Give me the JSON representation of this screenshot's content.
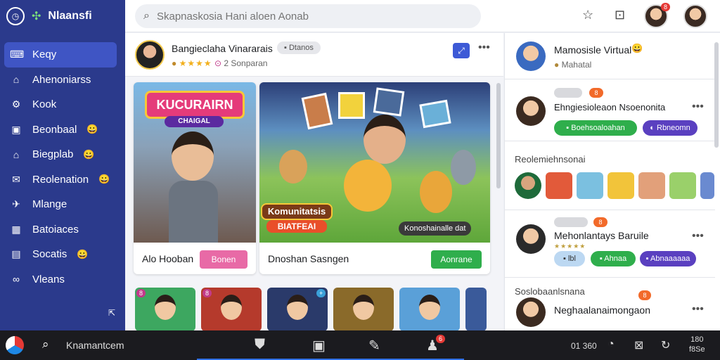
{
  "app": {
    "name": "Nlaansfi"
  },
  "sidebar": {
    "items": [
      {
        "label": "Keqy",
        "icon": "keyboard-icon",
        "emoji": ""
      },
      {
        "label": "Ahenoniarss",
        "icon": "home-icon",
        "emoji": ""
      },
      {
        "label": "Kook",
        "icon": "gear-icon",
        "emoji": ""
      },
      {
        "label": "Beonbaal",
        "icon": "store-icon",
        "emoji": "😀"
      },
      {
        "label": "Biegplab",
        "icon": "home-icon",
        "emoji": "😀"
      },
      {
        "label": "Reolenation",
        "icon": "mail-icon",
        "emoji": "😀"
      },
      {
        "label": "Mlange",
        "icon": "twitter-icon",
        "emoji": ""
      },
      {
        "label": "Batoiaces",
        "icon": "grid-icon",
        "emoji": ""
      },
      {
        "label": "Socatis",
        "icon": "users-icon",
        "emoji": "😀"
      },
      {
        "label": "Vleans",
        "icon": "infinity-icon",
        "emoji": ""
      }
    ]
  },
  "header": {
    "search_placeholder": "Skapnaskosia Hani aloen Aonab",
    "notification_count": "8"
  },
  "post": {
    "author": "Bangieclaha Vinararais",
    "chip": "Dtanos",
    "meta": "2 Sonparan",
    "rating": "★★★★"
  },
  "games": [
    {
      "title": "Alo Hooban",
      "button": "Bonen",
      "button_color": "#e86aa6",
      "logo_text": "KUCURAIRN",
      "logo_sub": "CHAIGAL"
    },
    {
      "title": "Dnoshan Sasngen",
      "button": "Aonrane",
      "button_color": "#2fae4c",
      "logo_text": "Komunitatsis",
      "logo_sub": "BIATFEAI",
      "overlay": "Konoshainalle dat"
    }
  ],
  "thumb_badges": [
    "8",
    "8",
    "",
    "",
    "",
    ""
  ],
  "right": {
    "profile": {
      "name": "Mamosisle Virtual",
      "emoji": "😀",
      "sub": "Mahatal"
    },
    "request1": {
      "name": "Ehngiesioleaon Nsoenonita",
      "accept": "Boehsoaloahan",
      "decline": "Rbneomn",
      "chip_a": "",
      "chip_b": "8"
    },
    "friends_label": "Reolemiehnsonai",
    "request2": {
      "name": "Mehonlantays Baruile",
      "btn1": "lbl",
      "btn2": "Ahnaa",
      "btn3": "Abnaaaaaa",
      "chip_b": "8"
    },
    "suggestions_label": "Soslobaanlsnana",
    "suggestion": {
      "name": "Neghaalanaimongaon",
      "chip": "8"
    }
  },
  "taskbar": {
    "search_label": "Knamantcem",
    "clock": "01 360",
    "date_line1": "180",
    "date_line2": "f8Se",
    "notify_badge": "6"
  },
  "colors": {
    "sidebar": "#2b3a8c",
    "accent": "#3d5ad6",
    "taskbar": "#1b1b1f"
  }
}
